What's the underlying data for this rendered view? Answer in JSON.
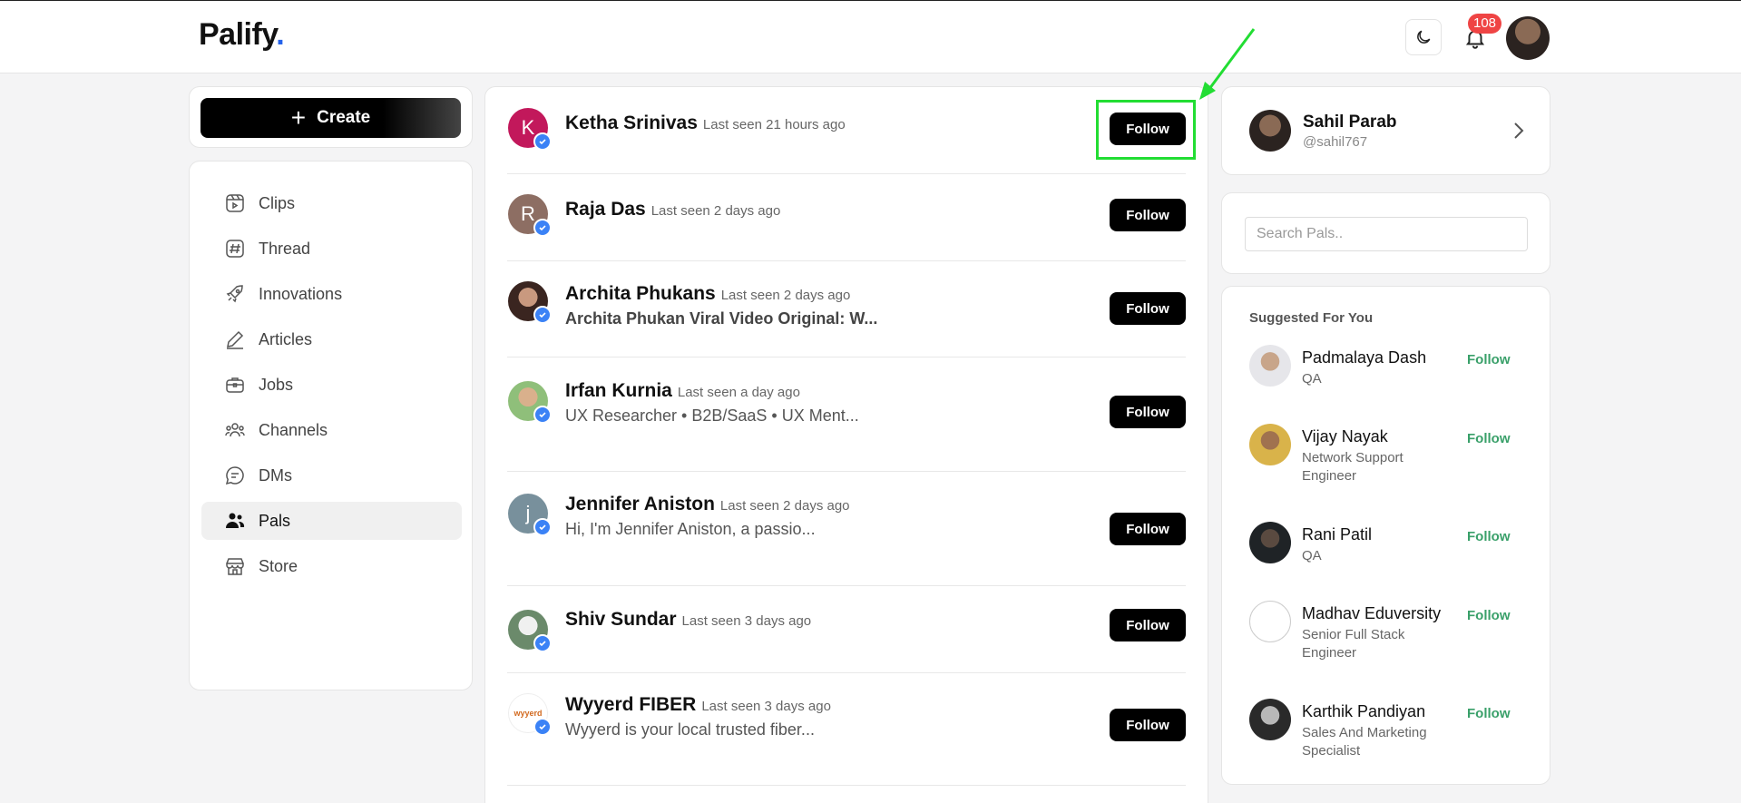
{
  "header": {
    "logo": "Palify",
    "logo_dot": ".",
    "notification_count": "108"
  },
  "sidebar": {
    "create_label": "Create",
    "items": [
      {
        "label": "Clips",
        "icon": "clips-icon"
      },
      {
        "label": "Thread",
        "icon": "hash-icon"
      },
      {
        "label": "Innovations",
        "icon": "rocket-icon"
      },
      {
        "label": "Articles",
        "icon": "pen-icon"
      },
      {
        "label": "Jobs",
        "icon": "briefcase-icon"
      },
      {
        "label": "Channels",
        "icon": "users-group-icon"
      },
      {
        "label": "DMs",
        "icon": "chat-icon"
      },
      {
        "label": "Pals",
        "icon": "pals-icon",
        "active": true
      },
      {
        "label": "Store",
        "icon": "store-icon"
      }
    ]
  },
  "feed": {
    "follow_label": "Follow",
    "rows": [
      {
        "name": "Ketha Srinivas",
        "seen": "Last seen 21 hours ago",
        "sub": "",
        "initial": "K",
        "avatar_color": "#c2185b"
      },
      {
        "name": "Raja Das",
        "seen": "Last seen 2 days ago",
        "sub": "",
        "initial": "R",
        "avatar_color": "#8d6e63"
      },
      {
        "name": "Archita Phukans",
        "seen": "Last seen 2 days ago",
        "sub": "Archita Phukan Viral Video Original: W...",
        "initial": "",
        "avatar_color": "#5a3a2e"
      },
      {
        "name": "Irfan Kurnia",
        "seen": "Last seen a day ago",
        "sub": "UX Researcher • B2B/SaaS • UX Ment...",
        "initial": "",
        "avatar_color": "#7a9a6a"
      },
      {
        "name": "Jennifer Aniston",
        "seen": "Last seen 2 days ago",
        "sub": "Hi, I'm Jennifer Aniston, a passio...",
        "initial": "j",
        "avatar_color": "#78909c"
      },
      {
        "name": "Shiv Sundar",
        "seen": "Last seen 3 days ago",
        "sub": "",
        "initial": "",
        "avatar_color": "#6b7d6b"
      },
      {
        "name": "Wyyerd FIBER",
        "seen": "Last seen 3 days ago",
        "sub": "Wyyerd is your local trusted fiber...",
        "initial": "wyyerd",
        "avatar_color": "#ffffff"
      }
    ]
  },
  "profile": {
    "name": "Sahil Parab",
    "handle": "@sahil767"
  },
  "search": {
    "placeholder": "Search Pals.."
  },
  "suggested": {
    "title": "Suggested For You",
    "follow_label": "Follow",
    "items": [
      {
        "name": "Padmalaya Dash",
        "role": "QA"
      },
      {
        "name": "Vijay Nayak",
        "role": "Network Support Engineer"
      },
      {
        "name": "Rani Patil",
        "role": "QA"
      },
      {
        "name": "Madhav Eduversity",
        "role": "Senior Full Stack Engineer"
      },
      {
        "name": "Karthik Pandiyan",
        "role": "Sales And Marketing Specialist"
      }
    ]
  },
  "colors": {
    "accent_dot": "#2563eb",
    "badge": "#ef4444",
    "suggest_follow": "#3aa06a",
    "highlight_box": "#22dd33",
    "verified": "#3b82f6"
  }
}
